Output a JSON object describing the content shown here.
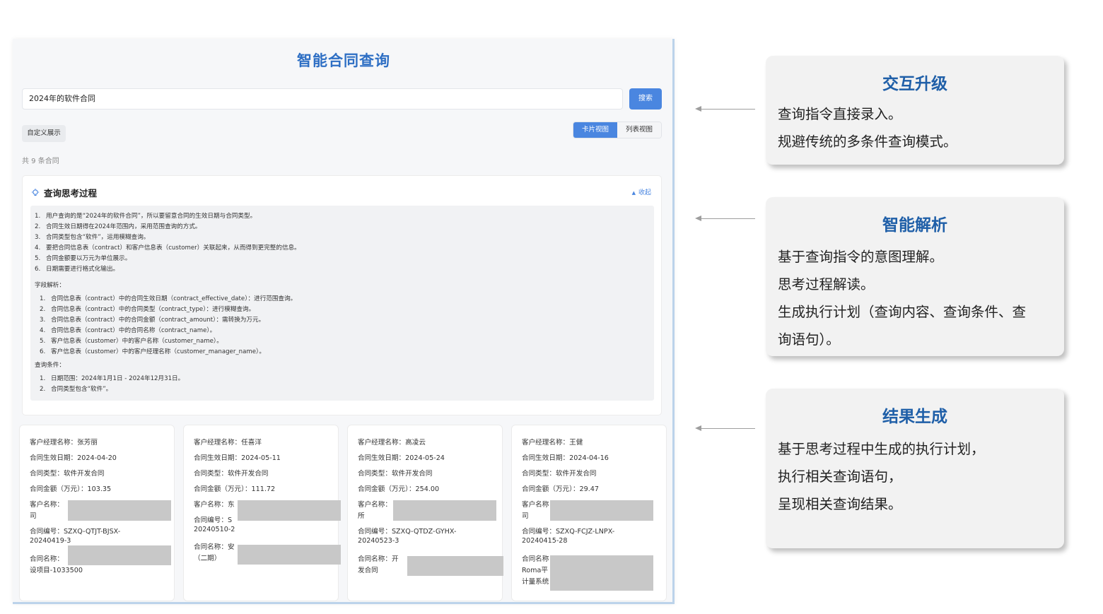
{
  "app": {
    "title": "智能合同查询",
    "search": {
      "value": "2024年的软件合同",
      "button": "搜索"
    },
    "custom_display": "自定义展示",
    "views": {
      "card": "卡片视图",
      "list": "列表视图"
    },
    "count": "共 9 条合同",
    "thinking": {
      "title": "查询思考过程",
      "collapse": "收起",
      "steps": [
        "用户查询的是“2024年的软件合同”，所以要留意合同的生效日期与合同类型。",
        "合同生效日期得在2024年范围内，采用范围查询的方式。",
        "合同类型包含“软件”，运用模糊查询。",
        "要把合同信息表（contract）和客户信息表（customer）关联起来，从而得到更完整的信息。",
        "合同金额要以万元为单位展示。",
        "日期需要进行格式化输出。"
      ],
      "fields_title": "字段解析：",
      "fields": [
        "合同信息表（contract）中的合同生效日期（contract_effective_date）：进行范围查询。",
        "合同信息表（contract）中的合同类型（contract_type）：进行模糊查询。",
        "合同信息表（contract）中的合同金额（contract_amount）：需转换为万元。",
        "合同信息表（contract）中的合同名称（contract_name）。",
        "客户信息表（customer）中的客户名称（customer_name）。",
        "客户信息表（customer）中的客户经理名称（customer_manager_name）。"
      ],
      "conditions_title": "查询条件：",
      "conditions": [
        "日期范围：2024年1月1日 - 2024年12月31日。",
        "合同类型包含“软件”。"
      ]
    },
    "cards": [
      {
        "manager": "客户经理名称：张芳丽",
        "date": "合同生效日期：2024-04-20",
        "type": "合同类型：软件开发合同",
        "amount": "合同金额（万元）：103.35",
        "customer_label": "客户名称：",
        "customer_tail": "司",
        "no_line1": "合同编号：SZXQ-QTJT-BJSX-",
        "no_line2": "20240419-3",
        "name_line1": "合同名称：",
        "name_line2": "设项目-1033500"
      },
      {
        "manager": "客户经理名称：任喜洋",
        "date": "合同生效日期：2024-05-11",
        "type": "合同类型：软件开发合同",
        "amount": "合同金额（万元）：111.72",
        "customer_label": "客户名称：东",
        "customer_tail": "",
        "no_line1": "合同编号：S",
        "no_line2": "20240510-2",
        "name_line1": "合同名称：安",
        "name_line2": "（二期）"
      },
      {
        "manager": "客户经理名称：高凌云",
        "date": "合同生效日期：2024-05-24",
        "type": "合同类型：软件开发合同",
        "amount": "合同金额（万元）：254.00",
        "customer_label": "客户名称：",
        "customer_tail": "所",
        "no_line1": "合同编号：SZXQ-QTDZ-GYHX-",
        "no_line2": "20240523-3",
        "name_line1": "合同名称：开",
        "name_line2": "发合同"
      },
      {
        "manager": "客户经理名称：王健",
        "date": "合同生效日期：2024-04-16",
        "type": "合同类型：软件开发合同",
        "amount": "合同金额（万元）：29.47",
        "customer_label": "客户名称",
        "customer_tail": "司",
        "no_line1": "合同编号：SZXQ-FCJZ-LNPX-",
        "no_line2": "20240415-28",
        "name_line1": "合同名称",
        "name_line2": "Roma平",
        "name_line3": "计量系统"
      }
    ]
  },
  "panels": [
    {
      "title": "交互升级",
      "lines": [
        "查询指令直接录入。",
        "规避传统的多条件查询模式。"
      ]
    },
    {
      "title": "智能解析",
      "lines": [
        "基于查询指令的意图理解。",
        "思考过程解读。",
        "生成执行计划（查询内容、查询条件、查",
        "询语句）。"
      ]
    },
    {
      "title": "结果生成",
      "lines": [
        "基于思考过程中生成的执行计划，",
        "执行相关查询语句，",
        "呈现相关查询结果。"
      ]
    }
  ]
}
